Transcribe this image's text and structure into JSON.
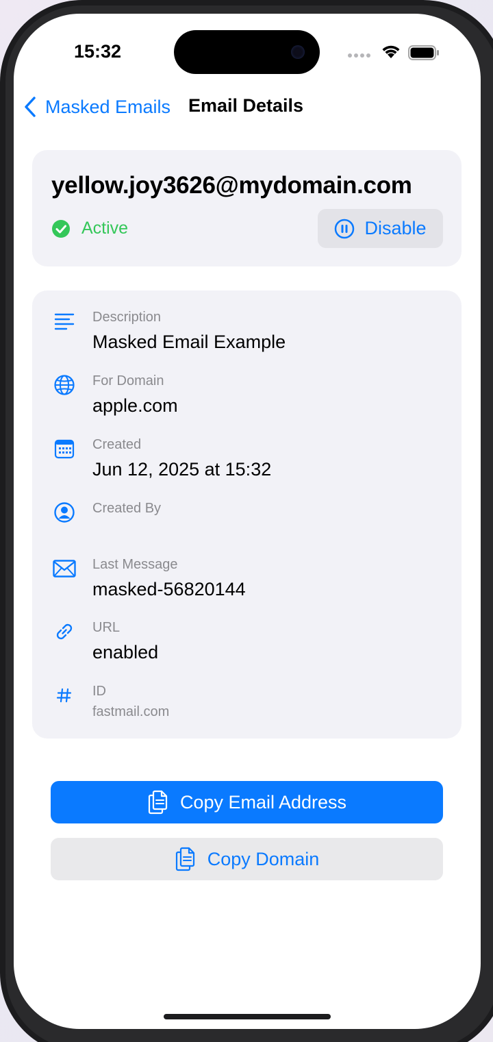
{
  "status_bar": {
    "time": "15:32"
  },
  "nav": {
    "back_label": "Masked Emails",
    "title": "Email Details"
  },
  "summary": {
    "email": "yellow.joy3626@mydomain.com",
    "status": "Active",
    "status_color": "#34c759",
    "disable_label": "Disable"
  },
  "details": {
    "description": {
      "label": "Description",
      "value": "Masked Email Example",
      "icon": "text-lines-icon"
    },
    "for_domain": {
      "label": "For Domain",
      "value": "apple.com",
      "icon": "globe-icon"
    },
    "created": {
      "label": "Created",
      "value": "Jun 12, 2025 at 15:32",
      "icon": "calendar-icon"
    },
    "created_by": {
      "label": "Created By",
      "value": "",
      "icon": "person-circle-icon"
    },
    "last_message": {
      "label": "Last Message",
      "value": "masked-56820144",
      "icon": "envelope-icon"
    },
    "url": {
      "label": "URL",
      "value": "enabled",
      "icon": "link-icon"
    },
    "id": {
      "label": "ID",
      "value": "fastmail.com",
      "icon": "hash-icon"
    }
  },
  "actions": {
    "copy_email_label": "Copy Email Address",
    "copy_domain_label": "Copy Domain"
  },
  "colors": {
    "accent": "#0a7aff",
    "card_background": "#f2f2f7"
  }
}
